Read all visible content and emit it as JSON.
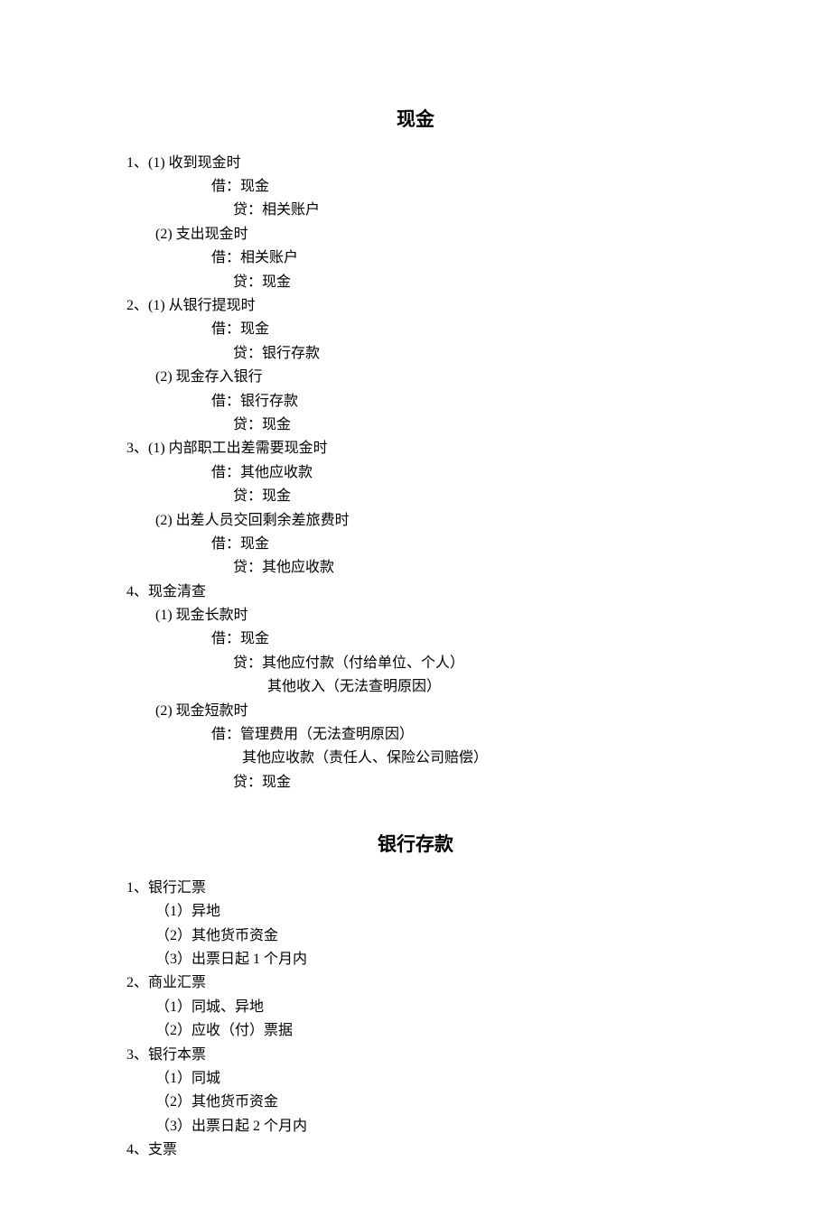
{
  "sections": [
    {
      "title": "现金",
      "lines": [
        {
          "indent": 0,
          "text": "1、(1) 收到现金时"
        },
        {
          "indent": 3,
          "text": "借：现金"
        },
        {
          "indent": 4,
          "text": "贷：相关账户"
        },
        {
          "indent": 1,
          "text": "(2) 支出现金时"
        },
        {
          "indent": 3,
          "text": "借：相关账户"
        },
        {
          "indent": 4,
          "text": "贷：现金"
        },
        {
          "indent": 0,
          "text": "2、(1) 从银行提现时"
        },
        {
          "indent": 3,
          "text": "借：现金"
        },
        {
          "indent": 4,
          "text": "贷：银行存款"
        },
        {
          "indent": 1,
          "text": "(2) 现金存入银行"
        },
        {
          "indent": 3,
          "text": "借：银行存款"
        },
        {
          "indent": 4,
          "text": "贷：现金"
        },
        {
          "indent": 0,
          "text": "3、(1) 内部职工出差需要现金时"
        },
        {
          "indent": 3,
          "text": "借：其他应收款"
        },
        {
          "indent": 4,
          "text": "贷：现金"
        },
        {
          "indent": 1,
          "text": "(2) 出差人员交回剩余差旅费时"
        },
        {
          "indent": 3,
          "text": "借：现金"
        },
        {
          "indent": 4,
          "text": "贷：其他应收款"
        },
        {
          "indent": 0,
          "text": "4、现金清查"
        },
        {
          "indent": 1,
          "text": "(1) 现金长款时"
        },
        {
          "indent": 3,
          "text": "借：现金"
        },
        {
          "indent": 4,
          "text": "贷：其他应付款（付给单位、个人）"
        },
        {
          "indent": 6,
          "text": "其他收入（无法查明原因）"
        },
        {
          "indent": 1,
          "text": "(2) 现金短款时"
        },
        {
          "indent": 3,
          "text": "借：管理费用（无法查明原因）"
        },
        {
          "indent": 5,
          "text": "其他应收款（责任人、保险公司赔偿）"
        },
        {
          "indent": 4,
          "text": "贷：现金"
        }
      ]
    },
    {
      "title": "银行存款",
      "lines": [
        {
          "indent": 0,
          "text": "1、银行汇票"
        },
        {
          "indent": 1,
          "text": "（1）异地"
        },
        {
          "indent": 1,
          "text": "（2）其他货币资金"
        },
        {
          "indent": 1,
          "text": "（3）出票日起 1 个月内"
        },
        {
          "indent": 0,
          "text": "2、商业汇票"
        },
        {
          "indent": 1,
          "text": "（1）同城、异地"
        },
        {
          "indent": 1,
          "text": "（2）应收（付）票据"
        },
        {
          "indent": 0,
          "text": "3、银行本票"
        },
        {
          "indent": 1,
          "text": "（1）同城"
        },
        {
          "indent": 1,
          "text": "（2）其他货币资金"
        },
        {
          "indent": 1,
          "text": "（3）出票日起 2 个月内"
        },
        {
          "indent": 0,
          "text": "4、支票"
        }
      ]
    }
  ]
}
